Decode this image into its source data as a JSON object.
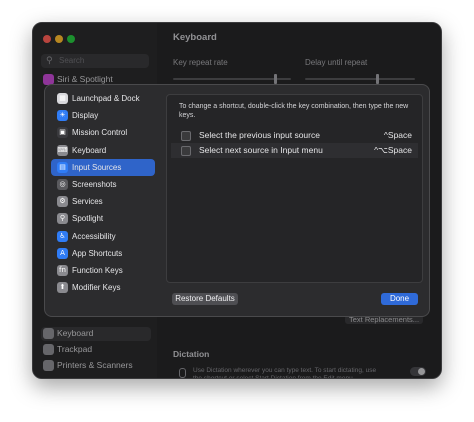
{
  "colors": {
    "red": "#ff5f57",
    "yellow": "#febc2e",
    "green": "#28c840",
    "accent": "#2f64c9",
    "done": "#2f6ad8"
  },
  "window": {
    "title": "Keyboard"
  },
  "sidebar": {
    "search_placeholder": "Search",
    "items_top": [
      {
        "label": "Siri & Spotlight",
        "color": "#c64ad4"
      }
    ],
    "items_bottom": [
      {
        "label": "Keyboard",
        "color": "#8e8e93"
      },
      {
        "label": "Trackpad",
        "color": "#8e8e93"
      },
      {
        "label": "Printers & Scanners",
        "color": "#8e8e93"
      }
    ]
  },
  "main": {
    "key_repeat_label": "Key repeat rate",
    "delay_label": "Delay until repeat",
    "text_replacements_button": "Text Replacements...",
    "dictation_heading": "Dictation",
    "dictation_description": "Use Dictation wherever you can type text. To start dictating, use the shortcut or select Start Dictation from the Edit menu."
  },
  "sheet": {
    "categories": [
      {
        "label": "Launchpad & Dock",
        "icon": "launchpad-icon",
        "glyph": "▦",
        "color": "#d8d8dc"
      },
      {
        "label": "Display",
        "icon": "display-icon",
        "glyph": "☀",
        "color": "#2f7cf6"
      },
      {
        "label": "Mission Control",
        "icon": "mission-control-icon",
        "glyph": "▣",
        "color": "#3a3a3e"
      },
      {
        "label": "Keyboard",
        "icon": "keyboard-icon",
        "glyph": "⌨",
        "color": "#8a8a8f"
      },
      {
        "label": "Input Sources",
        "icon": "input-sources-icon",
        "glyph": "▤",
        "color": "#2f7cf6"
      },
      {
        "label": "Screenshots",
        "icon": "screenshots-icon",
        "glyph": "◎",
        "color": "#5a5a5e"
      },
      {
        "label": "Services",
        "icon": "services-icon",
        "glyph": "⚙",
        "color": "#8a8a8f"
      },
      {
        "label": "Spotlight",
        "icon": "spotlight-icon",
        "glyph": "⚲",
        "color": "#8a8a8f"
      },
      {
        "label": "Accessibility",
        "icon": "accessibility-icon",
        "glyph": "♿",
        "color": "#2f7cf6"
      },
      {
        "label": "App Shortcuts",
        "icon": "app-shortcuts-icon",
        "glyph": "A",
        "color": "#2f7cf6"
      },
      {
        "label": "Function Keys",
        "icon": "function-keys-icon",
        "glyph": "fn",
        "color": "#8a8a8f"
      },
      {
        "label": "Modifier Keys",
        "icon": "modifier-keys-icon",
        "glyph": "⬆",
        "color": "#8a8a8f"
      }
    ],
    "selected": "Input Sources",
    "instructions": "To change a shortcut, double-click the key combination, then type the new keys.",
    "shortcuts": [
      {
        "name": "Select the previous input source",
        "keys": "^Space",
        "checked": false
      },
      {
        "name": "Select next source in Input menu",
        "keys": "^⌥Space",
        "checked": false
      }
    ],
    "restore_button": "Restore Defaults",
    "done_button": "Done"
  }
}
